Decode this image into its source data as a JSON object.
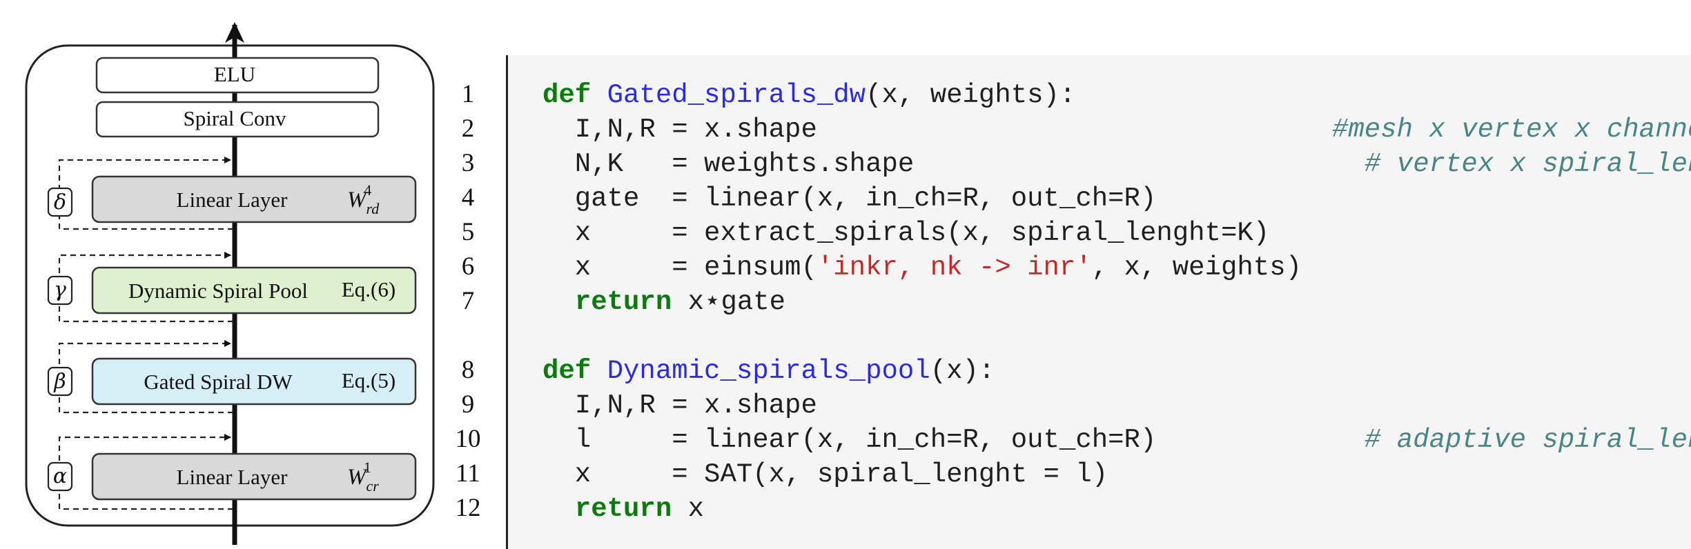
{
  "diagram": {
    "blocks": [
      {
        "label": "ELU",
        "eq": ""
      },
      {
        "label": "Spiral Conv",
        "eq": ""
      },
      {
        "label": "Linear Layer",
        "eq_base": "W",
        "eq_sub": "rd",
        "eq_sup": "4"
      },
      {
        "label": "Dynamic Spiral Pool",
        "eq": "Eq.(6)"
      },
      {
        "label": "Gated Spiral DW",
        "eq": "Eq.(5)"
      },
      {
        "label": "Linear Layer",
        "eq_base": "W",
        "eq_sub": "cr",
        "eq_sup": "1"
      }
    ],
    "gates": [
      "δ",
      "γ",
      "β",
      "α"
    ],
    "colors": {
      "linear_fill": "#d9d9d9",
      "pool_fill": "#dff0cf",
      "dw_fill": "#d6eef6",
      "plain_fill": "#ffffff",
      "stroke": "#333333"
    }
  },
  "line_numbers": [
    "1",
    "2",
    "3",
    "4",
    "5",
    "6",
    "7",
    "8",
    "9",
    "10",
    "11",
    "12"
  ],
  "code": {
    "l1": {
      "kw": "def",
      "fn": "Gated_spirals_dw",
      "rest": "(x, weights):"
    },
    "l2": {
      "text": "  I,N,R = x.shape",
      "comment": "#mesh x vertex x channels"
    },
    "l3": {
      "text": "  N,K   = weights.shape",
      "comment": "# vertex x spiral_lenght"
    },
    "l4": {
      "text": "  gate  = linear(x, in_ch=R, out_ch=R)"
    },
    "l5": {
      "text": "  x     = extract_spirals(x, spiral_lenght=K)"
    },
    "l6": {
      "pre": "  x     = einsum(",
      "str": "'inkr, nk -> inr'",
      "post": ", x, weights)"
    },
    "l7": {
      "kw": "return",
      "rest": " x⋆gate"
    },
    "l9": {
      "kw": "def",
      "fn": "Dynamic_spirals_pool",
      "rest": "(x):"
    },
    "l10": {
      "text": "  I,N,R = x.shape"
    },
    "l11": {
      "text": "  l     = linear(x, in_ch=R, out_ch=R)",
      "comment": "# adaptive spiral_lenght"
    },
    "l12": {
      "text": "  x     = SAT(x, spiral_lenght = l)"
    },
    "l13": {
      "kw": "return",
      "rest": " x"
    }
  }
}
